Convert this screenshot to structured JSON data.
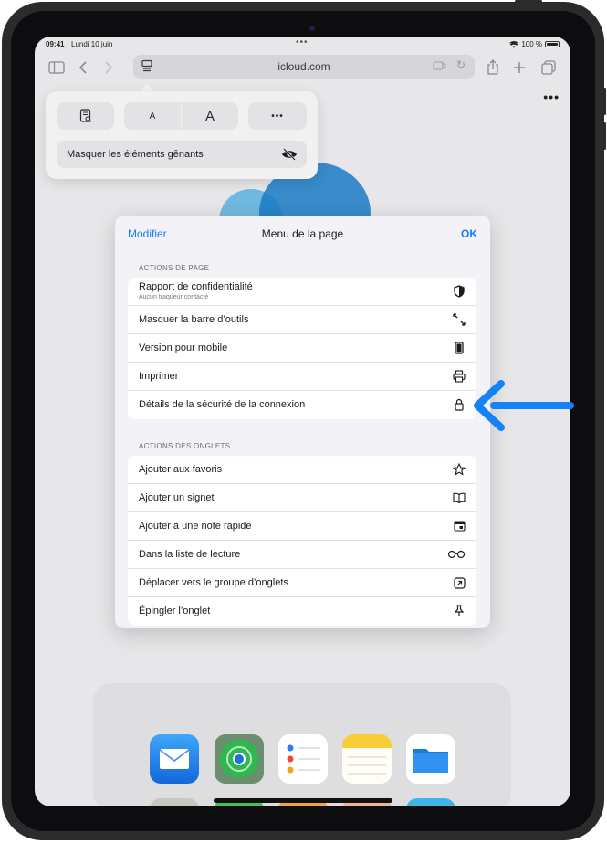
{
  "status_bar": {
    "time": "09:41",
    "date": "Lundi 10 juin",
    "battery": "100 %"
  },
  "toolbar": {
    "url": "icloud.com"
  },
  "page_menu_popover": {
    "small_text_label": "A",
    "large_text_label": "A",
    "more_label": "•••",
    "hide_distractions_label": "Masquer les éléments gênants"
  },
  "page_menu_sheet": {
    "edit_label": "Modifier",
    "title": "Menu de la page",
    "ok_label": "OK",
    "page_actions_header": "ACTIONS DE PAGE",
    "page_actions": [
      {
        "label": "Rapport de confidentialité",
        "sublabel": "Aucun traqueur contacté",
        "icon": "shield-icon"
      },
      {
        "label": "Masquer la barre d’outils",
        "icon": "resize-arrows-icon"
      },
      {
        "label": "Version pour mobile",
        "icon": "phone-icon"
      },
      {
        "label": "Imprimer",
        "icon": "printer-icon"
      },
      {
        "label": "Détails de la sécurité de la connexion",
        "icon": "lock-icon"
      }
    ],
    "tab_actions_header": "ACTIONS DES ONGLETS",
    "tab_actions": [
      {
        "label": "Ajouter aux favoris",
        "icon": "star-icon"
      },
      {
        "label": "Ajouter un signet",
        "icon": "book-icon"
      },
      {
        "label": "Ajouter à une note rapide",
        "icon": "quick-note-icon"
      },
      {
        "label": "Dans la liste de lecture",
        "icon": "glasses-icon"
      },
      {
        "label": "Déplacer vers le groupe d’onglets",
        "icon": "move-to-group-icon"
      },
      {
        "label": "Épingler l’onglet",
        "icon": "pin-icon"
      }
    ]
  },
  "colors": {
    "accent": "#1a7df2",
    "arrow": "#1582f5"
  }
}
